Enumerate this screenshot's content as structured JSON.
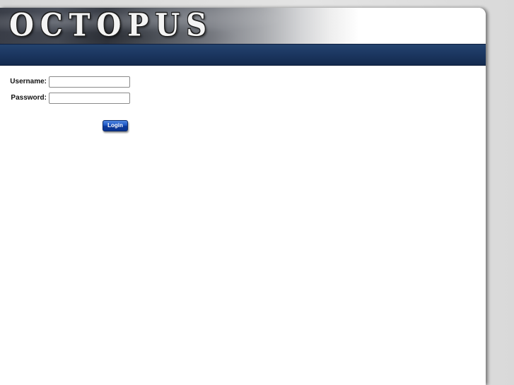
{
  "header": {
    "logo_text": "OCTOPUS"
  },
  "login": {
    "username_label": "Username:",
    "username_value": "",
    "password_label": "Password:",
    "password_value": "",
    "submit_label": "Login"
  },
  "colors": {
    "navbar": "#1b3660",
    "button": "#1d56c4",
    "page_background": "#ffffff"
  }
}
